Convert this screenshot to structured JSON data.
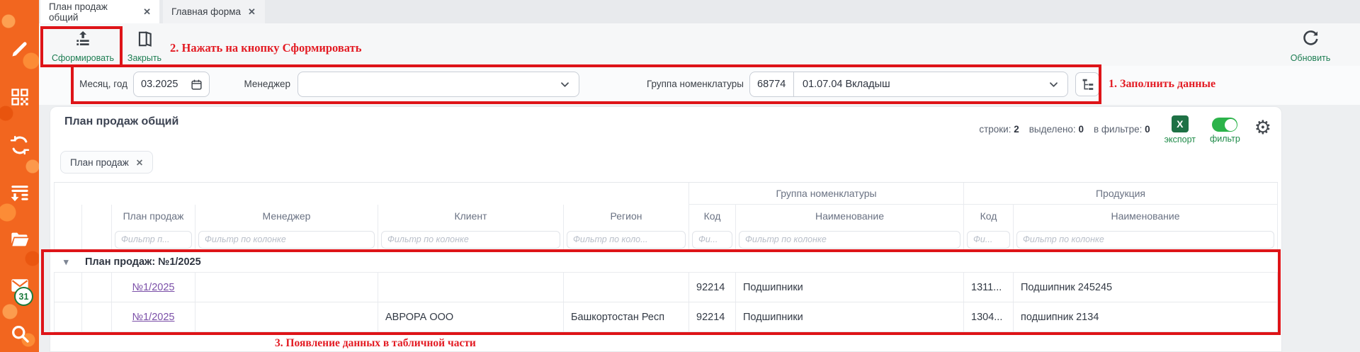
{
  "tabs": [
    {
      "label": "План продаж общий"
    },
    {
      "label": "Главная форма"
    }
  ],
  "toolbar": {
    "generate_label": "Сформировать",
    "close_label": "Закрыть",
    "refresh_label": "Обновить"
  },
  "filters": {
    "month_label": "Месяц, год",
    "month_value": "03.2025",
    "manager_label": "Менеджер",
    "manager_value": "",
    "group_label": "Группа номенклатуры",
    "group_code": "68774",
    "group_name": "01.07.04 Вкладыш"
  },
  "panel": {
    "title": "План продаж общий",
    "rows_label": "строки:",
    "rows_value": "2",
    "selected_label": "выделено:",
    "selected_value": "0",
    "filtered_label": "в фильтре:",
    "filtered_value": "0",
    "excel_letter": "X",
    "export_label": "экспорт",
    "filter_label": "фильтр"
  },
  "chip": {
    "label": "План продаж"
  },
  "table": {
    "group_headers": {
      "nomenclature": "Группа номенклатуры",
      "production": "Продукция"
    },
    "columns": {
      "plan": "План продаж",
      "manager": "Менеджер",
      "client": "Клиент",
      "region": "Регион",
      "code1": "Код",
      "name1": "Наименование",
      "code2": "Код",
      "name2": "Наименование"
    },
    "placeholders": {
      "plan": "Фильтр п...",
      "manager": "Фильтр по колонке",
      "client": "Фильтр по колонке",
      "region": "Фильтр по коло...",
      "code1": "Фи...",
      "name1": "Фильтр по колонке",
      "code2": "Фи...",
      "name2": "Фильтр по колонке"
    },
    "group_row_label": "План продаж: №1/2025",
    "rows": [
      {
        "plan": "№1/2025",
        "manager": "",
        "client": "",
        "region": "",
        "group_code": "92214",
        "group_name": "Подшипники",
        "prod_code": "1311...",
        "prod_name": "Подшипник 245245"
      },
      {
        "plan": "№1/2025",
        "manager": "",
        "client": "АВРОРА ООО",
        "region": "Башкортостан Респ",
        "group_code": "92214",
        "group_name": "Подшипники",
        "prod_code": "1304...",
        "prod_name": "подшипник 2134"
      }
    ]
  },
  "annotations": {
    "step1": "1. Заполнить данные",
    "step2": "2. Нажать на кнопку Сформировать",
    "step3": "3. Появление данных в табличной части"
  },
  "sidebar": {
    "mail_badge": "31"
  },
  "glyphs": {
    "close": "✕",
    "triangle": "▾",
    "gear": "⚙"
  },
  "colors": {
    "sidebar_orange": "#f2661f",
    "action_green": "#1d7d52",
    "excel_green": "#1e7145",
    "toggle_green": "#2cb34a",
    "link_purple": "#7b4fa8",
    "annotation_red": "#e31b23",
    "box_red": "#de1418"
  }
}
